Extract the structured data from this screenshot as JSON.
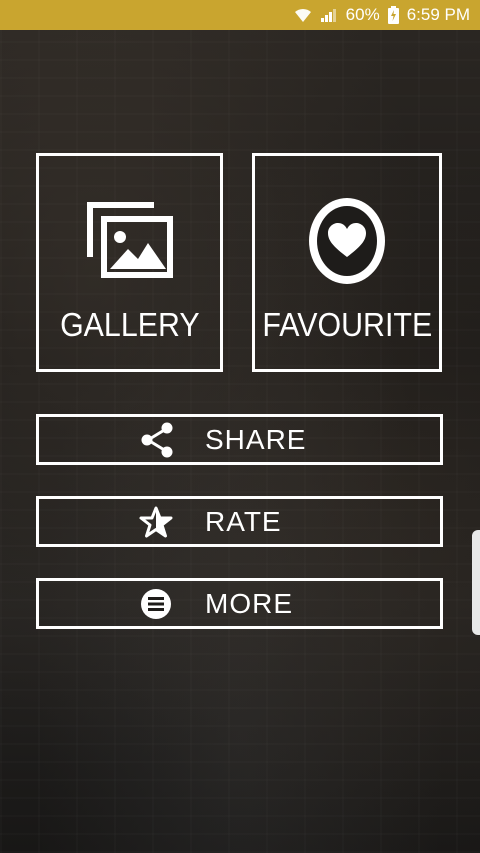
{
  "status": {
    "battery": "60%",
    "time": "6:59 PM"
  },
  "tiles": {
    "gallery": {
      "label": "GALLERY",
      "icon": "gallery-icon"
    },
    "favourite": {
      "label": "FAVOURITE",
      "icon": "heart-circle-icon"
    }
  },
  "menu": {
    "share": {
      "label": "SHARE",
      "icon": "share-icon"
    },
    "rate": {
      "label": "RATE",
      "icon": "star-icon"
    },
    "more": {
      "label": "MORE",
      "icon": "menu-circle-icon"
    }
  },
  "colors": {
    "status_bar": "#c9a52f",
    "outline": "#ffffff"
  }
}
